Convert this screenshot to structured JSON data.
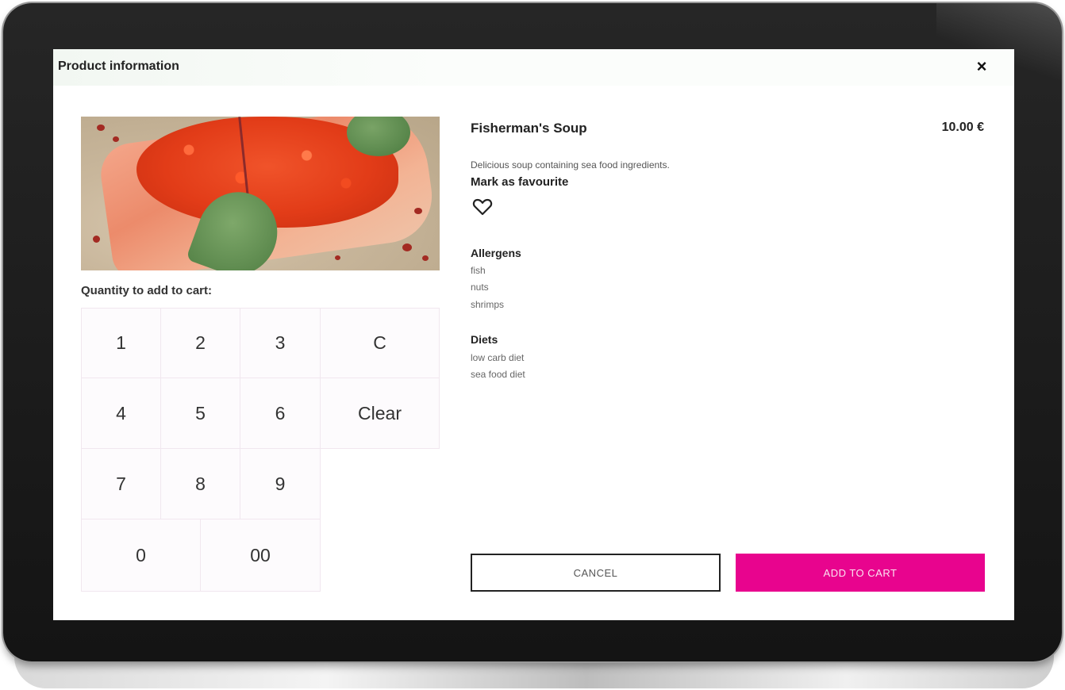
{
  "dialog": {
    "title": "Product information",
    "close_icon": "close-icon"
  },
  "product": {
    "name": "Fisherman's Soup",
    "price": "10.00 €",
    "description": "Delicious soup containing sea food ingredients.",
    "favourite_label": "Mark as favourite",
    "favourite_icon": "heart-outline-icon"
  },
  "quantity": {
    "label": "Quantity to add to cart:",
    "keys": [
      "1",
      "2",
      "3",
      "C",
      "4",
      "5",
      "6",
      "Clear",
      "7",
      "8",
      "9",
      "0",
      "00"
    ]
  },
  "allergens": {
    "title": "Allergens",
    "items": [
      "fish",
      "nuts",
      "shrimps"
    ]
  },
  "diets": {
    "title": "Diets",
    "items": [
      "low carb diet",
      "sea food diet"
    ]
  },
  "actions": {
    "cancel_label": "CANCEL",
    "add_label": "ADD TO CART"
  },
  "colors": {
    "accent": "#e8048e",
    "header_bg": "#f5f9f5",
    "keypad_bg": "#fdfbfd"
  }
}
